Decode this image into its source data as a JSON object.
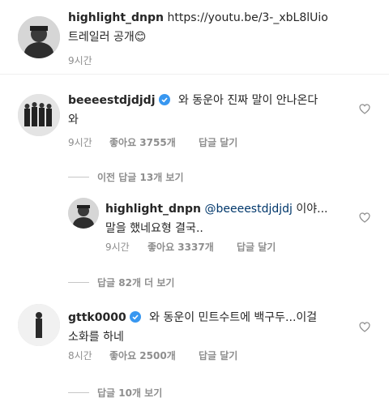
{
  "caption": {
    "username": "highlight_dnpn",
    "link": "https://youtu.be/3-_xbL8lUio",
    "text": "트레일러 공개😊",
    "time": "9시간"
  },
  "comment1": {
    "username": "beeeestdjdjdj",
    "text_line1": "와 동운아 진짜 말이 안나온다",
    "text_line2": "와",
    "time": "9시간",
    "likes": "좋아요 3755개",
    "reply_label": "답글 달기",
    "view_previous": "이전 답글 13개 보기"
  },
  "reply1": {
    "username": "highlight_dnpn",
    "mention": "@beeeestdjdjdj",
    "text_line1_tail": "이야...",
    "text_line2": "말을 했네요형 결국..",
    "time": "9시간",
    "likes": "좋아요 3337개",
    "reply_label": "답글 달기",
    "view_more": "답글 82개 더 보기"
  },
  "comment2": {
    "username": "gttk0000",
    "text_line1": "와 동운이 민트수트에 백구두...이걸",
    "text_line2": "소화를 하네",
    "time": "8시간",
    "likes": "좋아요 2500개",
    "reply_label": "답글 달기",
    "view_replies": "답글 10개 보기"
  },
  "colors": {
    "verified": "#3897f0",
    "secondary_text": "#8e8e8e",
    "mention": "#00376b"
  }
}
